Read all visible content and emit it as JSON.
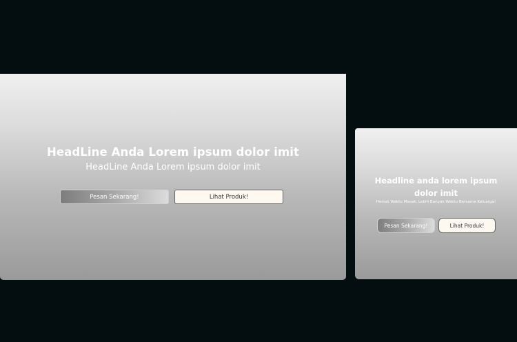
{
  "desktop": {
    "headline": "HeadLine Anda Lorem ipsum dolor imit",
    "subheadline": "HeadLine Anda Lorem ipsum dolor imit",
    "order_button": "Pesan Sekarang!",
    "product_button": "Lihat Produk!"
  },
  "mobile": {
    "headline": "Headline anda lorem ipsum dolor imit",
    "tagline": "Hemat Waktu Masak, Lebih Banyak Waktu Bersama Keluarga!",
    "order_button": "Pesan Sekarang!",
    "product_button": "Lihat Produk!"
  },
  "colors": {
    "background": "#040e10",
    "secondary_button_bg": "#fdf9f1"
  }
}
